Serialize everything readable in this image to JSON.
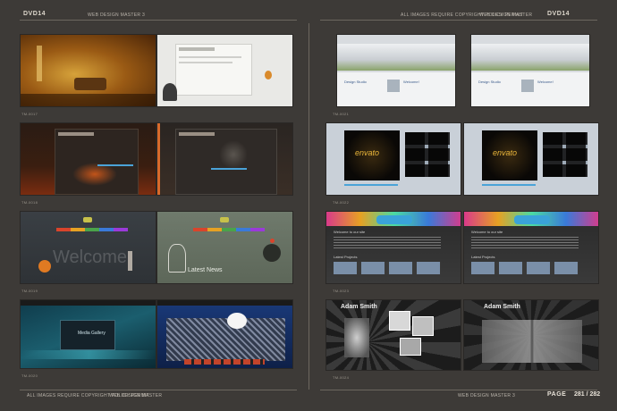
{
  "header": {
    "left_dvd": "DVD14",
    "left_title": "WEB DESIGN MASTER 3",
    "right_notice": "ALL IMAGES REQUIRE COPYRIGHT POLICY PERMIT",
    "right_notice2": "WEB DESIGN MASTER",
    "right_dvd": "DVD14"
  },
  "footer": {
    "left_notice": "ALL IMAGES REQUIRE COPYRIGHT POLICY PERMIT",
    "left_notice2": "WEB DESIGN MASTER",
    "right_title": "WEB DESIGN MASTER 3",
    "page_label": "PAGE",
    "page_numbers": "281 / 282"
  },
  "thumbnails": {
    "t1_caption": "TM-0017",
    "t2_caption": "TM-0018",
    "t3_caption": "TM-0019",
    "t4_caption": "TM-0020",
    "t5_caption": "TM-0021",
    "t6_caption": "TM-0022",
    "t7_caption": "TM-0023",
    "t8_caption": "TM-0024",
    "design_studio": "Design Studio",
    "welcome": "Welcome!",
    "ivato": "envato",
    "latest_news": "Latest News",
    "welcome_big": "Welcome",
    "media_gallery": "Media Gallery",
    "adam_smith": "Adam Smith",
    "welcome_site": "Welcome to our site",
    "latest_projects": "Latest Projects"
  },
  "colors": {
    "page_bg": "#3d3a37",
    "accent_orange": "#d98a2b",
    "accent_blue": "#4aa3d8"
  }
}
